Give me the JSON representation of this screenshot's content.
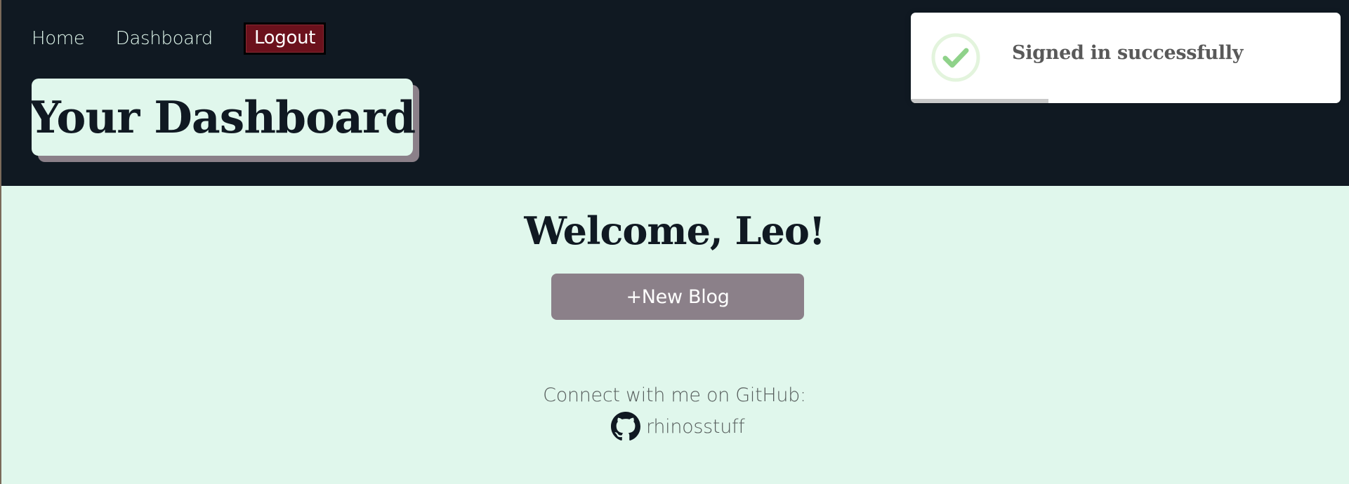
{
  "nav": {
    "home_label": "Home",
    "dashboard_label": "Dashboard",
    "logout_label": "Logout"
  },
  "header": {
    "title": "Your Dashboard"
  },
  "toast": {
    "message": "Signed in successfully",
    "icon": "check-circle-icon",
    "progress_remaining": 0.32,
    "accent_color": "#8fd28a"
  },
  "main": {
    "welcome": "Welcome, Leo!",
    "new_blog_label": "+New Blog",
    "connect_text": "Connect with me on GitHub:",
    "github_handle": "rhinosstuff",
    "github_icon": "github-icon"
  },
  "colors": {
    "header_bg": "#101922",
    "page_bg": "#e0f7ec",
    "logout_bg": "#6b111c",
    "button_bg": "#8b8089"
  }
}
